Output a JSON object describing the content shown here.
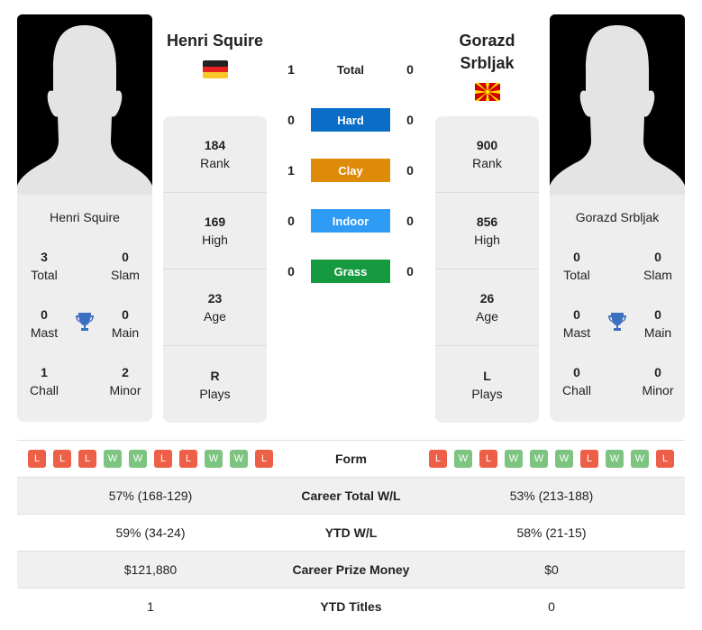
{
  "colors": {
    "hard": "#0a6dc6",
    "clay": "#df8b0a",
    "indoor": "#2e9bf4",
    "grass": "#169a3f",
    "loss": "#ee5f47",
    "win": "#7cc47f",
    "trophy": "#3b6fbf"
  },
  "player1": {
    "name": "Henri Squire",
    "flag": "germany-flag",
    "rank": "184",
    "rank_label": "Rank",
    "high": "169",
    "high_label": "High",
    "age": "23",
    "age_label": "Age",
    "plays": "R",
    "plays_label": "Plays",
    "titles": {
      "total": "3",
      "total_label": "Total",
      "slam": "0",
      "slam_label": "Slam",
      "mast": "0",
      "mast_label": "Mast",
      "main": "0",
      "main_label": "Main",
      "chall": "1",
      "chall_label": "Chall",
      "minor": "2",
      "minor_label": "Minor"
    },
    "form": [
      "L",
      "L",
      "L",
      "W",
      "W",
      "L",
      "L",
      "W",
      "W",
      "L"
    ],
    "career_wl": "57% (168-129)",
    "ytd_wl": "59% (34-24)",
    "prize": "$121,880",
    "ytd_titles": "1"
  },
  "player2": {
    "name_line1": "Gorazd",
    "name_line2": "Srbljak",
    "name": "Gorazd Srbljak",
    "flag": "north-macedonia-flag",
    "rank": "900",
    "rank_label": "Rank",
    "high": "856",
    "high_label": "High",
    "age": "26",
    "age_label": "Age",
    "plays": "L",
    "plays_label": "Plays",
    "titles": {
      "total": "0",
      "total_label": "Total",
      "slam": "0",
      "slam_label": "Slam",
      "mast": "0",
      "mast_label": "Mast",
      "main": "0",
      "main_label": "Main",
      "chall": "0",
      "chall_label": "Chall",
      "minor": "0",
      "minor_label": "Minor"
    },
    "form": [
      "L",
      "W",
      "L",
      "W",
      "W",
      "W",
      "L",
      "W",
      "W",
      "L"
    ],
    "career_wl": "53% (213-188)",
    "ytd_wl": "58% (21-15)",
    "prize": "$0",
    "ytd_titles": "0"
  },
  "h2h": [
    {
      "label": "Total",
      "p1": "1",
      "p2": "0",
      "surface": null
    },
    {
      "label": "Hard",
      "p1": "0",
      "p2": "0",
      "surface": "hard"
    },
    {
      "label": "Clay",
      "p1": "1",
      "p2": "0",
      "surface": "clay"
    },
    {
      "label": "Indoor",
      "p1": "0",
      "p2": "0",
      "surface": "indoor"
    },
    {
      "label": "Grass",
      "p1": "0",
      "p2": "0",
      "surface": "grass"
    }
  ],
  "table": {
    "form_label": "Form",
    "career_wl_label": "Career Total W/L",
    "ytd_wl_label": "YTD W/L",
    "prize_label": "Career Prize Money",
    "ytd_titles_label": "YTD Titles"
  }
}
